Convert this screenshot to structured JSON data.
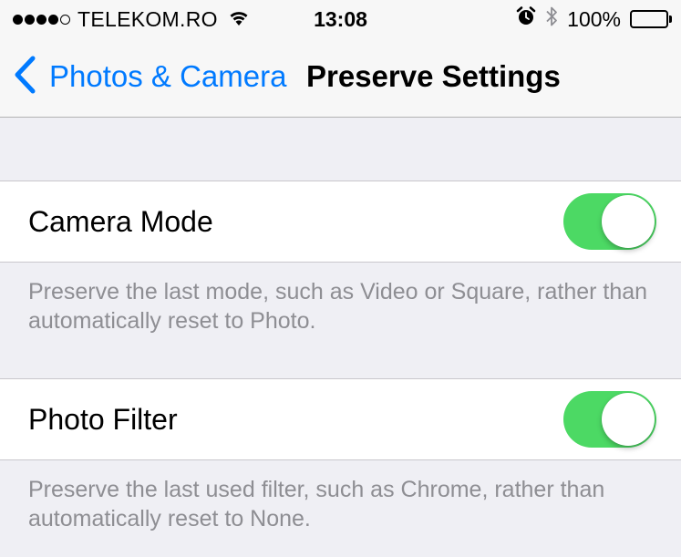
{
  "status_bar": {
    "carrier": "TELEKOM.RO",
    "time": "13:08",
    "battery": "100%",
    "signal_bars": 4,
    "battery_level": 1.0
  },
  "nav": {
    "back_label": "Photos & Camera",
    "title": "Preserve Settings"
  },
  "settings": [
    {
      "label": "Camera Mode",
      "on": true,
      "footer": "Preserve the last mode, such as Video or Square, rather than automatically reset to Photo."
    },
    {
      "label": "Photo Filter",
      "on": true,
      "footer": "Preserve the last used filter, such as Chrome, rather than automatically reset to None."
    }
  ],
  "colors": {
    "accent": "#007aff",
    "toggle_on": "#4cd964",
    "background": "#efeff4"
  }
}
